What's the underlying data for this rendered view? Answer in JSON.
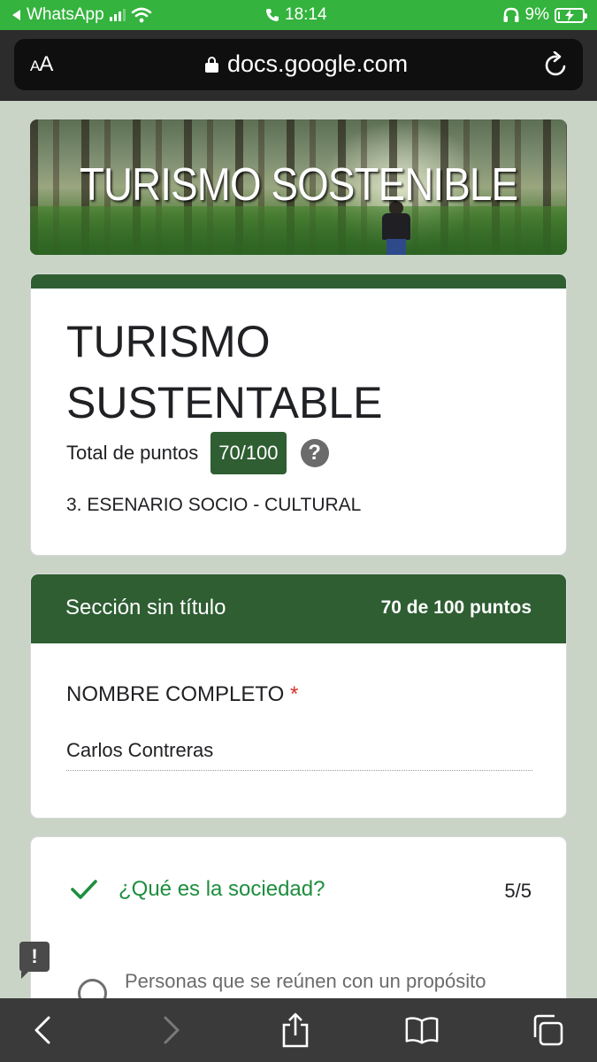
{
  "status_bar": {
    "back_app": "WhatsApp",
    "time": "18:14",
    "battery": "9%",
    "battery_level": 0.09,
    "signal_bars": 3,
    "icons": [
      "back-arrow-icon",
      "signal-icon",
      "wifi-icon",
      "phone-icon",
      "headphones-icon",
      "battery-charging-icon"
    ]
  },
  "browser": {
    "text_size_label_small": "A",
    "text_size_label_large": "A",
    "url": "docs.google.com",
    "icons": [
      "lock-icon",
      "reload-icon"
    ]
  },
  "banner": {
    "title": "TURISMO SOSTENIBLE"
  },
  "form": {
    "title": "TURISMO SUSTENTABLE",
    "total_label": "Total de puntos",
    "total_value": "70/100",
    "help_symbol": "?",
    "description": "3. ESENARIO SOCIO - CULTURAL"
  },
  "section": {
    "title": "Sección sin título",
    "points": "70 de 100 puntos",
    "question_label": "NOMBRE COMPLETO",
    "required_mark": "*",
    "answer": "Carlos Contreras"
  },
  "quiz": {
    "question": "¿Qué es la sociedad?",
    "score": "5/5",
    "option_text": "Personas que se reúnen con un propósito"
  },
  "feedback": {
    "symbol": "!"
  },
  "toolbar": {
    "icons": [
      "back-icon",
      "forward-icon",
      "share-icon",
      "bookmarks-icon",
      "tabs-icon"
    ]
  },
  "colors": {
    "status_green": "#34b33e",
    "form_accent": "#2e5e32",
    "page_bg": "#c9d4c7",
    "correct_green": "#1e8e3e",
    "required_red": "#d93025"
  }
}
